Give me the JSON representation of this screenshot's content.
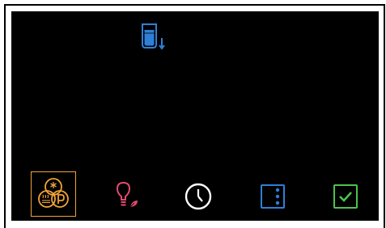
{
  "corner": {
    "text": ""
  },
  "status": {
    "icon": "water-tank-drain-icon",
    "color": "#2f7fd6"
  },
  "toolbar": {
    "mode": {
      "icon": "multi-mode-icon",
      "color": "#f0a23a"
    },
    "light": {
      "icon": "lightbulb-icon",
      "color": "#e24a6e",
      "leaf_color": "#e24a6e"
    },
    "timer": {
      "icon": "clock-icon",
      "color": "#ffffff"
    },
    "menu": {
      "icon": "vertical-dots-icon",
      "color": "#2f7fd6"
    },
    "confirm": {
      "icon": "checkmark-icon",
      "color": "#4cc34c"
    }
  }
}
